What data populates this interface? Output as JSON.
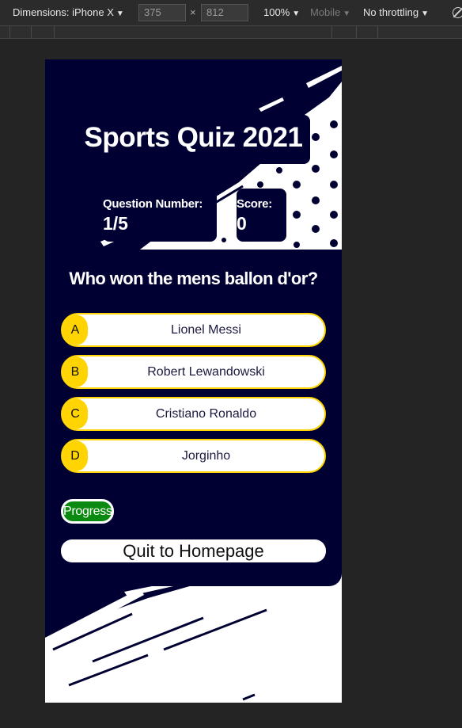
{
  "devtools": {
    "dimensions_label": "Dimensions: iPhone X",
    "width_value": "375",
    "height_value": "812",
    "times": "×",
    "zoom": "100%",
    "device_type": "Mobile",
    "throttling": "No throttling"
  },
  "quiz": {
    "title": "Sports Quiz 2021",
    "question_number_label": "Question Number:",
    "question_number_value": "1/5",
    "score_label": "Score:",
    "score_value": "0",
    "question": "Who won the mens ballon d'or?",
    "answers": [
      {
        "letter": "A",
        "text": "Lionel Messi"
      },
      {
        "letter": "B",
        "text": "Robert Lewandowski"
      },
      {
        "letter": "C",
        "text": "Cristiano Ronaldo"
      },
      {
        "letter": "D",
        "text": "Jorginho"
      }
    ],
    "progress_label": "Progress",
    "quit_label": "Quit to Homepage"
  },
  "colors": {
    "navy": "#000033",
    "accent_yellow": "#ffd400",
    "progress_green": "#0a8a10"
  }
}
